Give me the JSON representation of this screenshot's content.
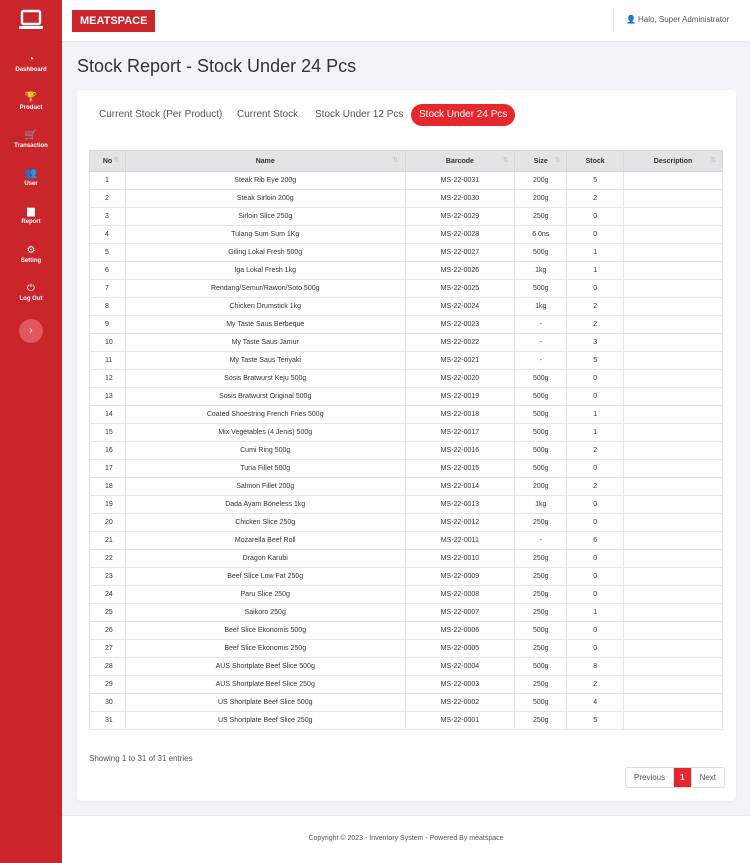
{
  "sidebar": {
    "items": [
      {
        "label": "Dashboard",
        "icon": "dashboard-icon",
        "glyph": "◔"
      },
      {
        "label": "Product",
        "icon": "trophy-icon",
        "glyph": "🏆"
      },
      {
        "label": "Transaction",
        "icon": "cart-icon",
        "glyph": "🛒"
      },
      {
        "label": "User",
        "icon": "users-icon",
        "glyph": "👥"
      },
      {
        "label": "Report",
        "icon": "chart-icon",
        "glyph": "▆"
      },
      {
        "label": "Setting",
        "icon": "gears-icon",
        "glyph": "⚙"
      },
      {
        "label": "Log Out",
        "icon": "power-icon",
        "glyph": "⏻"
      }
    ],
    "toggle_glyph": "›"
  },
  "header": {
    "brand": "MEATSPACE",
    "user_greeting": "Halo, Super Administrator"
  },
  "page_title": "Stock Report - Stock Under 24 Pcs",
  "tabs": [
    {
      "label": "Current Stock (Per Product)",
      "active": false
    },
    {
      "label": "Current Stock",
      "active": false
    },
    {
      "label": "Stock Under 12 Pcs",
      "active": false
    },
    {
      "label": "Stock Under 24 Pcs",
      "active": true
    }
  ],
  "table": {
    "columns": [
      "No",
      "Name",
      "Barcode",
      "Size",
      "Stock",
      "Description"
    ],
    "rows": [
      [
        "1",
        "Steak Rib Eye 200g",
        "MS-22-0031",
        "200g",
        "5",
        ""
      ],
      [
        "2",
        "Steak Sirloin 200g",
        "MS-22-0030",
        "200g",
        "2",
        ""
      ],
      [
        "3",
        "Sirloin Slice 250g",
        "MS-22-0029",
        "250g",
        "0",
        ""
      ],
      [
        "4",
        "Tulang Sum Sum 1Kg",
        "MS-22-0028",
        "6 0ns",
        "0",
        ""
      ],
      [
        "5",
        "Giling Lokal Fresh 500g",
        "MS-22-0027",
        "500g",
        "1",
        ""
      ],
      [
        "6",
        "Iga Lokal Fresh 1kg",
        "MS-22-0026",
        "1kg",
        "1",
        ""
      ],
      [
        "7",
        "Rendang/Semur/Rawon/Soto 500g",
        "MS-22-0025",
        "500g",
        "0",
        ""
      ],
      [
        "8",
        "Chicken Drumstick 1kg",
        "MS-22-0024",
        "1kg",
        "2",
        ""
      ],
      [
        "9",
        "My Taste Saus Berbeque",
        "MS-22-0023",
        "-",
        "2",
        ""
      ],
      [
        "10",
        "My Taste Saus Jamur",
        "MS-22-0022",
        "-",
        "3",
        ""
      ],
      [
        "11",
        "My Taste Saus Teriyaki",
        "MS-22-0021",
        "-",
        "5",
        ""
      ],
      [
        "12",
        "Sosis Bratwurst Keju 500g",
        "MS-22-0020",
        "500g",
        "0",
        ""
      ],
      [
        "13",
        "Sosis Bratwurst Original 500g",
        "MS-22-0019",
        "500g",
        "0",
        ""
      ],
      [
        "14",
        "Coated Shoestring French Fries 500g",
        "MS-22-0018",
        "500g",
        "1",
        ""
      ],
      [
        "15",
        "Mix Vegetables (4 Jenis) 500g",
        "MS-22-0017",
        "500g",
        "1",
        ""
      ],
      [
        "16",
        "Cumi Ring 500g",
        "MS-22-0016",
        "500g",
        "2",
        ""
      ],
      [
        "17",
        "Tuna Fillet 500g",
        "MS-22-0015",
        "500g",
        "0",
        ""
      ],
      [
        "18",
        "Salmon Fillet 200g",
        "MS-22-0014",
        "200g",
        "2",
        ""
      ],
      [
        "19",
        "Dada Ayam Boneless 1kg",
        "MS-22-0013",
        "1kg",
        "0",
        ""
      ],
      [
        "20",
        "Chicken Slice 250g",
        "MS-22-0012",
        "250g",
        "0",
        ""
      ],
      [
        "21",
        "Mozarella Beef Roll",
        "MS-22-0011",
        "-",
        "6",
        ""
      ],
      [
        "22",
        "Dragon Karubi",
        "MS-22-0010",
        "250g",
        "0",
        ""
      ],
      [
        "23",
        "Beef Slice Low Fat 250g",
        "MS-22-0009",
        "250g",
        "0",
        ""
      ],
      [
        "24",
        "Paru Slice 250g",
        "MS-22-0008",
        "250g",
        "0",
        ""
      ],
      [
        "25",
        "Saikoro 250g",
        "MS-22-0007",
        "250g",
        "1",
        ""
      ],
      [
        "26",
        "Beef Slice Ekonomis 500g",
        "MS-22-0006",
        "500g",
        "0",
        ""
      ],
      [
        "27",
        "Beef Slice Ekonomis 250g",
        "MS-22-0005",
        "250g",
        "0",
        ""
      ],
      [
        "28",
        "AUS Shortplate Beef Slice 500g",
        "MS-22-0004",
        "500g",
        "8",
        ""
      ],
      [
        "29",
        "AUS Shortplate Beef Slice 250g",
        "MS-22-0003",
        "250g",
        "2",
        ""
      ],
      [
        "30",
        "US Shortplate Beef Slice 500g",
        "MS-22-0002",
        "500g",
        "4",
        ""
      ],
      [
        "31",
        "US Shortplate Beef Slice 250g",
        "MS-22-0001",
        "250g",
        "5",
        ""
      ]
    ]
  },
  "entries_info": "Showing 1 to 31 of 31 entries",
  "pagination": {
    "previous": "Previous",
    "current": "1",
    "next": "Next"
  },
  "footer": "Copyright © 2023 - Inventory System - Powered By meatspace",
  "colors": {
    "accent": "#c9252b",
    "active_tab": "#e6282e"
  }
}
